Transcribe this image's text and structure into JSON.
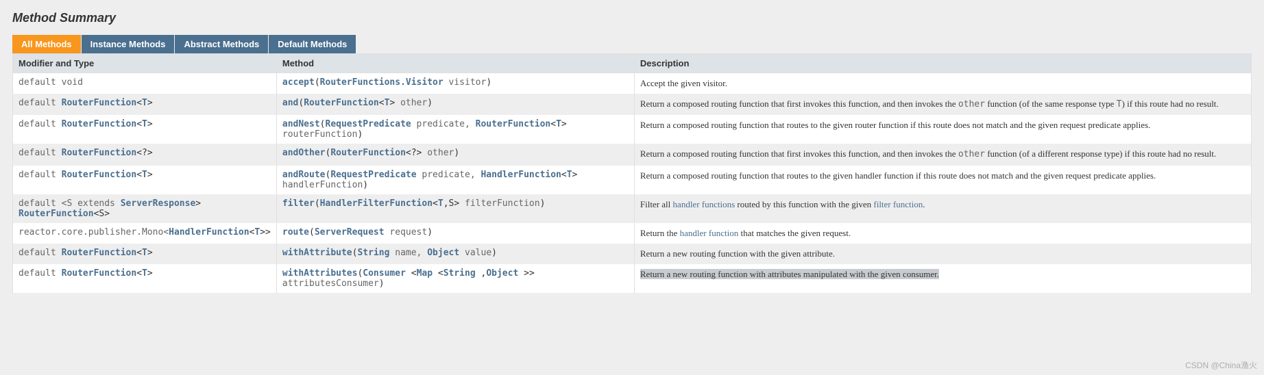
{
  "header": {
    "title": "Method Summary"
  },
  "tabs": [
    {
      "label": "All Methods",
      "active": true
    },
    {
      "label": "Instance Methods",
      "active": false
    },
    {
      "label": "Abstract Methods",
      "active": false
    },
    {
      "label": "Default Methods",
      "active": false
    }
  ],
  "columns": {
    "modifier": "Modifier and Type",
    "method": "Method",
    "description": "Description"
  },
  "rows": [
    {
      "modifier": [
        {
          "t": "kw",
          "v": "default "
        },
        {
          "t": "kw",
          "v": "void"
        }
      ],
      "method": [
        {
          "t": "mname",
          "v": "accept"
        },
        {
          "t": "punct",
          "v": "("
        },
        {
          "t": "type-link",
          "v": "RouterFunctions.Visitor"
        },
        {
          "t": "param",
          "v": " visitor"
        },
        {
          "t": "punct",
          "v": ")"
        }
      ],
      "description": [
        {
          "t": "text",
          "v": "Accept the given visitor."
        }
      ]
    },
    {
      "modifier": [
        {
          "t": "kw",
          "v": "default "
        },
        {
          "t": "type-link",
          "v": "RouterFunction"
        },
        {
          "t": "punct",
          "v": "<"
        },
        {
          "t": "type-link",
          "v": "T"
        },
        {
          "t": "punct",
          "v": ">"
        }
      ],
      "method": [
        {
          "t": "mname",
          "v": "and"
        },
        {
          "t": "punct",
          "v": "("
        },
        {
          "t": "type-link",
          "v": "RouterFunction"
        },
        {
          "t": "punct",
          "v": "<"
        },
        {
          "t": "type-link",
          "v": "T"
        },
        {
          "t": "punct",
          "v": ">"
        },
        {
          "t": "param",
          "v": " other"
        },
        {
          "t": "punct",
          "v": ")"
        }
      ],
      "description": [
        {
          "t": "text",
          "v": "Return a composed routing function that first invokes this function, and then invokes the "
        },
        {
          "t": "code",
          "v": "other"
        },
        {
          "t": "text",
          "v": " function (of the same response type "
        },
        {
          "t": "code",
          "v": "T"
        },
        {
          "t": "text",
          "v": ") if this route had no result."
        }
      ]
    },
    {
      "modifier": [
        {
          "t": "kw",
          "v": "default "
        },
        {
          "t": "type-link",
          "v": "RouterFunction"
        },
        {
          "t": "punct",
          "v": "<"
        },
        {
          "t": "type-link",
          "v": "T"
        },
        {
          "t": "punct",
          "v": ">"
        }
      ],
      "method": [
        {
          "t": "mname",
          "v": "andNest"
        },
        {
          "t": "punct",
          "v": "("
        },
        {
          "t": "type-link",
          "v": "RequestPredicate"
        },
        {
          "t": "param",
          "v": " predicate, "
        },
        {
          "t": "type-link",
          "v": "RouterFunction"
        },
        {
          "t": "punct",
          "v": "<"
        },
        {
          "t": "type-link",
          "v": "T"
        },
        {
          "t": "punct",
          "v": ">"
        },
        {
          "t": "param",
          "v": " routerFunction"
        },
        {
          "t": "punct",
          "v": ")"
        }
      ],
      "description": [
        {
          "t": "text",
          "v": "Return a composed routing function that routes to the given router function if this route does not match and the given request predicate applies."
        }
      ]
    },
    {
      "modifier": [
        {
          "t": "kw",
          "v": "default "
        },
        {
          "t": "type-link",
          "v": "RouterFunction"
        },
        {
          "t": "punct",
          "v": "<?>"
        }
      ],
      "method": [
        {
          "t": "mname",
          "v": "andOther"
        },
        {
          "t": "punct",
          "v": "("
        },
        {
          "t": "type-link",
          "v": "RouterFunction"
        },
        {
          "t": "punct",
          "v": "<?>"
        },
        {
          "t": "param",
          "v": " other"
        },
        {
          "t": "punct",
          "v": ")"
        }
      ],
      "description": [
        {
          "t": "text",
          "v": "Return a composed routing function that first invokes this function, and then invokes the "
        },
        {
          "t": "code",
          "v": "other"
        },
        {
          "t": "text",
          "v": " function (of a different response type) if this route had no result."
        }
      ]
    },
    {
      "modifier": [
        {
          "t": "kw",
          "v": "default "
        },
        {
          "t": "type-link",
          "v": "RouterFunction"
        },
        {
          "t": "punct",
          "v": "<"
        },
        {
          "t": "type-link",
          "v": "T"
        },
        {
          "t": "punct",
          "v": ">"
        }
      ],
      "method": [
        {
          "t": "mname",
          "v": "andRoute"
        },
        {
          "t": "punct",
          "v": "("
        },
        {
          "t": "type-link",
          "v": "RequestPredicate"
        },
        {
          "t": "param",
          "v": " predicate, "
        },
        {
          "t": "type-link",
          "v": "HandlerFunction"
        },
        {
          "t": "punct",
          "v": "<"
        },
        {
          "t": "type-link",
          "v": "T"
        },
        {
          "t": "punct",
          "v": ">"
        },
        {
          "t": "param",
          "v": " handlerFunction"
        },
        {
          "t": "punct",
          "v": ")"
        }
      ],
      "description": [
        {
          "t": "text",
          "v": "Return a composed routing function that routes to the given handler function if this route does not match and the given request predicate applies."
        }
      ]
    },
    {
      "modifier": [
        {
          "t": "kw",
          "v": "default <S extends "
        },
        {
          "t": "type-link",
          "v": "ServerResponse"
        },
        {
          "t": "punct",
          "v": ">"
        },
        {
          "t": "br"
        },
        {
          "t": "type-link",
          "v": "RouterFunction"
        },
        {
          "t": "punct",
          "v": "<S>"
        }
      ],
      "method": [
        {
          "t": "mname",
          "v": "filter"
        },
        {
          "t": "punct",
          "v": "("
        },
        {
          "t": "type-link",
          "v": "HandlerFilterFunction"
        },
        {
          "t": "punct",
          "v": "<"
        },
        {
          "t": "type-link",
          "v": "T"
        },
        {
          "t": "punct",
          "v": ",S>"
        },
        {
          "t": "param",
          "v": " filterFunction"
        },
        {
          "t": "punct",
          "v": ")"
        }
      ],
      "description": [
        {
          "t": "text",
          "v": "Filter all "
        },
        {
          "t": "link",
          "v": "handler functions"
        },
        {
          "t": "text",
          "v": " routed by this function with the given "
        },
        {
          "t": "link",
          "v": "filter function"
        },
        {
          "t": "text",
          "v": "."
        }
      ]
    },
    {
      "modifier": [
        {
          "t": "kw",
          "v": "reactor.core.publisher.Mono<"
        },
        {
          "t": "type-link",
          "v": "HandlerFunction"
        },
        {
          "t": "punct",
          "v": "<"
        },
        {
          "t": "type-link",
          "v": "T"
        },
        {
          "t": "punct",
          "v": ">>"
        }
      ],
      "method": [
        {
          "t": "mname",
          "v": "route"
        },
        {
          "t": "punct",
          "v": "("
        },
        {
          "t": "type-link",
          "v": "ServerRequest"
        },
        {
          "t": "param",
          "v": " request"
        },
        {
          "t": "punct",
          "v": ")"
        }
      ],
      "description": [
        {
          "t": "text",
          "v": "Return the "
        },
        {
          "t": "link",
          "v": "handler function"
        },
        {
          "t": "text",
          "v": " that matches the given request."
        }
      ]
    },
    {
      "modifier": [
        {
          "t": "kw",
          "v": "default "
        },
        {
          "t": "type-link",
          "v": "RouterFunction"
        },
        {
          "t": "punct",
          "v": "<"
        },
        {
          "t": "type-link",
          "v": "T"
        },
        {
          "t": "punct",
          "v": ">"
        }
      ],
      "method": [
        {
          "t": "mname",
          "v": "withAttribute"
        },
        {
          "t": "punct",
          "v": "("
        },
        {
          "t": "type-link",
          "v": "String"
        },
        {
          "t": "param",
          "v": "  name, "
        },
        {
          "t": "type-link",
          "v": "Object"
        },
        {
          "t": "param",
          "v": "  value"
        },
        {
          "t": "punct",
          "v": ")"
        }
      ],
      "description": [
        {
          "t": "text",
          "v": "Return a new routing function with the given attribute."
        }
      ]
    },
    {
      "modifier": [
        {
          "t": "kw",
          "v": "default "
        },
        {
          "t": "type-link",
          "v": "RouterFunction"
        },
        {
          "t": "punct",
          "v": "<"
        },
        {
          "t": "type-link",
          "v": "T"
        },
        {
          "t": "punct",
          "v": ">"
        }
      ],
      "method": [
        {
          "t": "mname",
          "v": "withAttributes"
        },
        {
          "t": "punct",
          "v": "("
        },
        {
          "t": "type-link",
          "v": "Consumer"
        },
        {
          "t": "punct",
          "v": " <"
        },
        {
          "t": "type-link",
          "v": "Map"
        },
        {
          "t": "punct",
          "v": " <"
        },
        {
          "t": "type-link",
          "v": "String"
        },
        {
          "t": "punct",
          "v": " ,"
        },
        {
          "t": "type-link",
          "v": "Object"
        },
        {
          "t": "punct",
          "v": " >>"
        },
        {
          "t": "param",
          "v": " attributesConsumer"
        },
        {
          "t": "punct",
          "v": ")"
        }
      ],
      "description": [
        {
          "t": "text",
          "v": "Return a new routing function with attributes manipulated with the given consumer."
        }
      ],
      "highlight": true
    }
  ],
  "watermark": "CSDN @China渔火"
}
